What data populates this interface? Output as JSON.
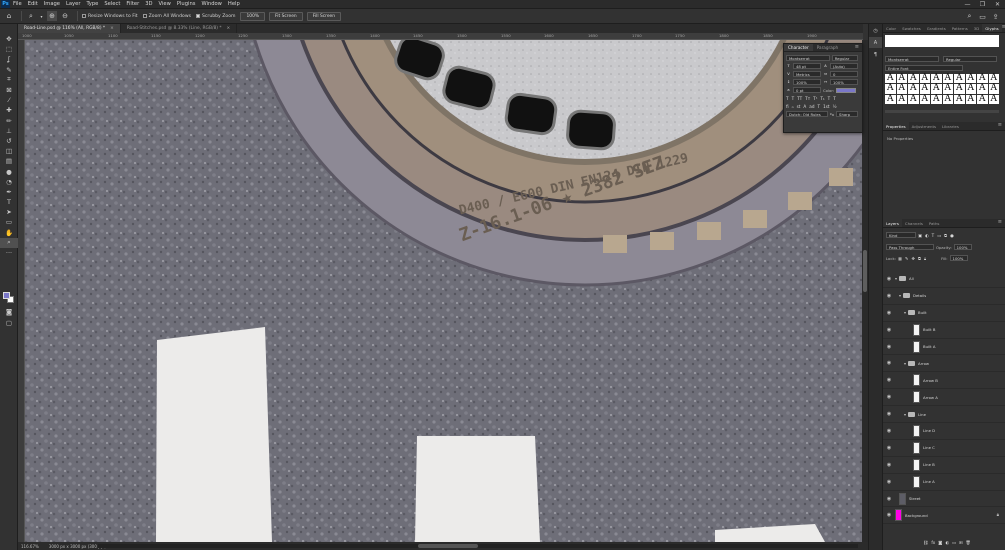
{
  "menubar": {
    "logo": "Ps",
    "items": [
      "File",
      "Edit",
      "Image",
      "Layer",
      "Type",
      "Select",
      "Filter",
      "3D",
      "View",
      "Plugins",
      "Window",
      "Help"
    ],
    "window_controls": [
      "—",
      "❐",
      "✕"
    ]
  },
  "options": {
    "resize_windows": "Resize Windows to Fit",
    "zoom_all": "Zoom All Windows",
    "scrubby_zoom": "Scrubby Zoom",
    "zoom_100": "100%",
    "fit_screen": "Fit Screen",
    "fill_screen": "Fill Screen"
  },
  "tabs": [
    {
      "label": "Road-Line.psd @ 116% (All, RGB/8) *"
    },
    {
      "label": "Road-Stitches.psd @ 8.33% (Line, RGB/8) *"
    }
  ],
  "ruler": {
    "top": [
      "1000",
      "1050",
      "1100",
      "1150",
      "1200",
      "1250",
      "1300",
      "1350",
      "1400",
      "1450",
      "1500",
      "1550",
      "1600",
      "1650",
      "1700",
      "1750",
      "1800",
      "1850",
      "1900"
    ]
  },
  "status": {
    "zoom": "116.67%",
    "doc": "3000 px x 3000 px (300 ppi)"
  },
  "character": {
    "tab1": "Character",
    "tab2": "Paragraph",
    "font_family": "Montserrat",
    "font_style": "Regular",
    "size": "48 pt",
    "leading": "(Auto)",
    "kerning": "Metrics",
    "tracking": "0",
    "vscale": "100%",
    "hscale": "100%",
    "baseline": "0 pt",
    "color_label": "Color:",
    "color": "#7a77c9",
    "lang": "Dutch: Old Rules",
    "aa": "Sharp",
    "styles_row": [
      "T",
      "T",
      "TT",
      "Tᴛ",
      "T¹",
      "T₁",
      "T",
      "T"
    ],
    "ot_row": [
      "fi",
      "ℴ",
      "st",
      "A",
      "ad",
      "T",
      "1st",
      "½"
    ]
  },
  "glyphs": {
    "tabs": [
      "Color",
      "Swatches",
      "Gradients",
      "Patterns",
      "3D",
      "Glyphs"
    ],
    "font": "Montserrat",
    "style": "Regular",
    "filter": "Entire Font",
    "cells": [
      "A",
      "A",
      "A",
      "A",
      "A",
      "A",
      "A",
      "A",
      "A",
      "A",
      "A",
      "A",
      "A",
      "A",
      "A",
      "A",
      "A",
      "A",
      "A",
      "A",
      "A",
      "A",
      "A",
      "A",
      "A",
      "A",
      "A",
      "A",
      "A",
      "A"
    ]
  },
  "properties": {
    "tabs": [
      "Properties",
      "Adjustments",
      "Libraries"
    ],
    "empty": "No Properties"
  },
  "layers": {
    "tabs": [
      "Layers",
      "Channels",
      "Paths"
    ],
    "kind": "Kind",
    "blend": "Pass Through",
    "opacity_label": "Opacity:",
    "opacity": "100%",
    "lock_label": "Lock:",
    "fill_label": "Fill:",
    "fill": "100%",
    "items": [
      {
        "name": "All",
        "kind": "group",
        "indent": 0
      },
      {
        "name": "Details",
        "kind": "group",
        "indent": 1
      },
      {
        "name": "Built",
        "kind": "group",
        "indent": 2
      },
      {
        "name": "Built B",
        "kind": "layer",
        "indent": 3
      },
      {
        "name": "Built A",
        "kind": "layer",
        "indent": 3
      },
      {
        "name": "Arrow",
        "kind": "group",
        "indent": 2
      },
      {
        "name": "Arrow B",
        "kind": "layer",
        "indent": 3
      },
      {
        "name": "Arrow A",
        "kind": "layer",
        "indent": 3
      },
      {
        "name": "Line",
        "kind": "group",
        "indent": 2
      },
      {
        "name": "Line D",
        "kind": "layer",
        "indent": 3
      },
      {
        "name": "Line C",
        "kind": "layer",
        "indent": 3
      },
      {
        "name": "Line B",
        "kind": "layer",
        "indent": 3
      },
      {
        "name": "Line A",
        "kind": "layer",
        "indent": 3
      },
      {
        "name": "Street",
        "kind": "layer-dark",
        "indent": 1
      },
      {
        "name": "Background",
        "kind": "layer-pink",
        "indent": 0
      }
    ]
  },
  "canvas": {
    "manhole_text_outer": "Z-16.1-06 ★ 2382 SEZ",
    "manhole_text_inner": "D400 / E600 DIN EN124  DIN 1229"
  }
}
